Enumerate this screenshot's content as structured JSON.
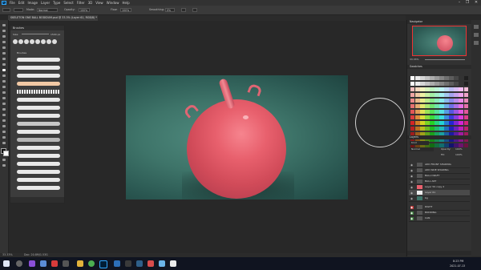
{
  "app": {
    "logo": "Ps",
    "menu": [
      "File",
      "Edit",
      "Image",
      "Layer",
      "Type",
      "Select",
      "Filter",
      "3D",
      "View",
      "Window",
      "Help"
    ],
    "window_controls": [
      "–",
      "❐",
      "✕"
    ]
  },
  "options_bar": {
    "mode_label": "Mode:",
    "mode_value": "Normal",
    "opacity_label": "Opacity:",
    "opacity_value": "100%",
    "flow_label": "Flow:",
    "flow_value": "100%",
    "smoothing_label": "Smoothing:",
    "smoothing_value": "0%"
  },
  "document_tab": {
    "label": "SKELETON ONE BALL BODIDUM.psd @ 33.3% (Layer 61, RGB/8) *"
  },
  "brushes_panel": {
    "title": "Brushes",
    "size_label": "Size:",
    "size_value": "1500 px",
    "folder_label": "Brushes"
  },
  "navigator": {
    "title": "Navigator",
    "zoom_value": "33.33%"
  },
  "swatches": {
    "title": "Swatches"
  },
  "layers": {
    "title": "Layers",
    "kind_filter": "Kind",
    "blend_mode": "Normal",
    "opacity_label": "Opacity:",
    "opacity_value": "100%",
    "fill_label": "Fill:",
    "fill_value": "100%",
    "items": [
      {
        "name": "ADD FRONT SHADING"
      },
      {
        "name": "ADD SIDE SHADING"
      },
      {
        "name": "BALL DRAFT"
      },
      {
        "name": "BALL ART"
      },
      {
        "name": "Layer 59 copy 2"
      },
      {
        "name": "Layer 61"
      },
      {
        "name": "bg"
      },
      {
        "name": "RIGHT"
      },
      {
        "name": "BODDING"
      },
      {
        "name": "CAN"
      }
    ]
  },
  "status_bar": {
    "zoom": "33.33%",
    "doc_info": "Doc: 20.8M/1.53G"
  },
  "taskbar": {
    "time": "8:23 PM",
    "date": "2021-07-13"
  },
  "colors": {
    "ball": "#e8606d",
    "background": "#3e7469",
    "accent": "#31a8ff"
  }
}
